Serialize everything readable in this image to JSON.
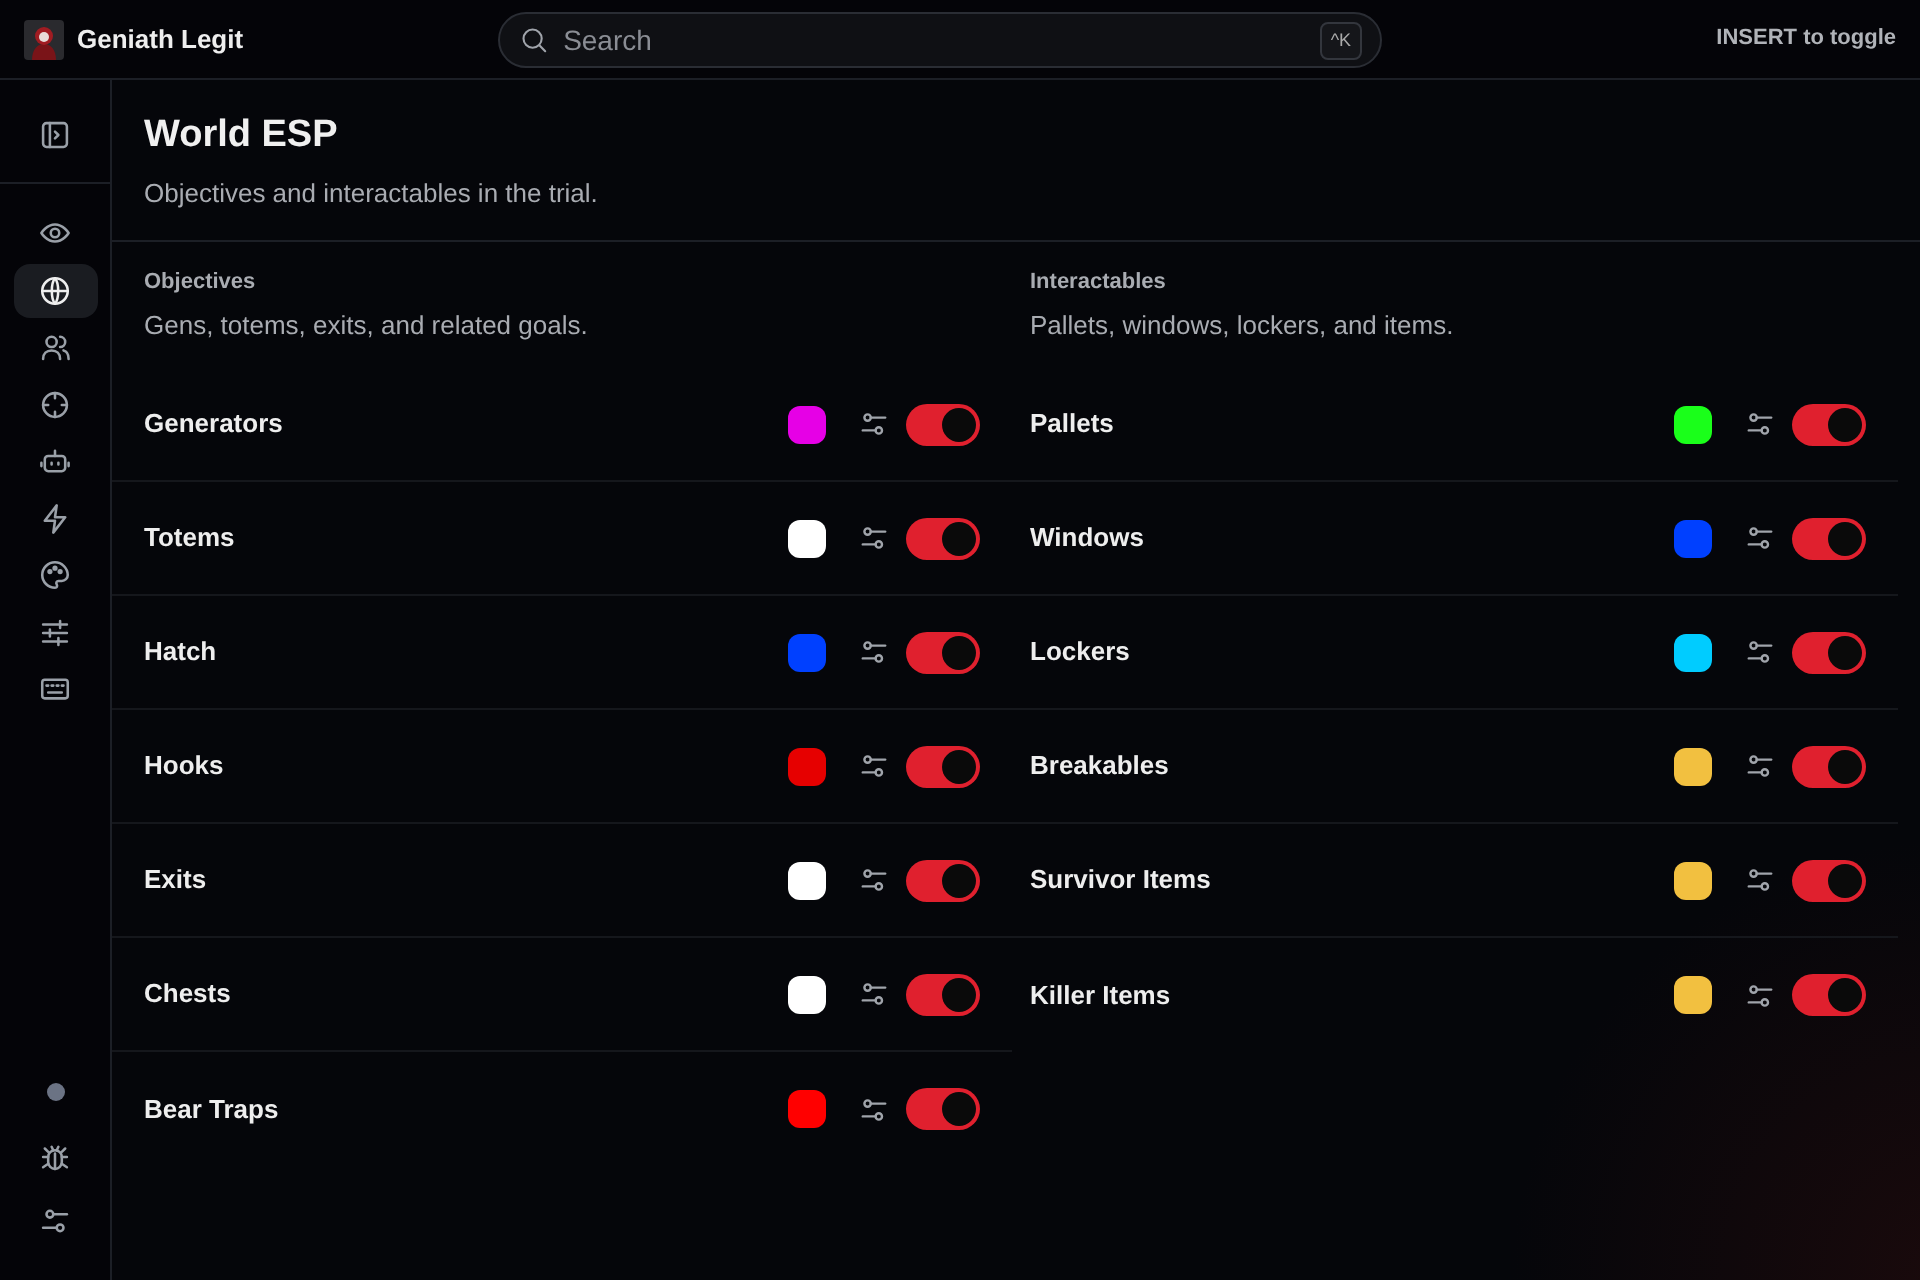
{
  "app": {
    "name": "Geniath Legit"
  },
  "search": {
    "placeholder": "Search",
    "shortcut": "^K"
  },
  "hint": "INSERT to toggle",
  "sidebar": {
    "top": [
      {
        "kind": "panel",
        "selected": false
      }
    ],
    "items": [
      {
        "kind": "eye",
        "selected": false
      },
      {
        "kind": "globe",
        "selected": true
      },
      {
        "kind": "users",
        "selected": false
      },
      {
        "kind": "crosshair",
        "selected": false
      },
      {
        "kind": "bot",
        "selected": false
      },
      {
        "kind": "bolt",
        "selected": false
      },
      {
        "kind": "palette",
        "selected": false
      },
      {
        "kind": "sliders",
        "selected": false
      },
      {
        "kind": "keyboard",
        "selected": false
      }
    ],
    "bottom": [
      {
        "kind": "dot",
        "selected": false
      },
      {
        "kind": "bug",
        "selected": false
      },
      {
        "kind": "settings",
        "selected": false
      }
    ]
  },
  "page": {
    "title": "World ESP",
    "subtitle": "Objectives and interactables in the trial."
  },
  "sections": [
    {
      "title": "Objectives",
      "description": "Gens, totems, exits, and related goals.",
      "items": [
        {
          "label": "Generators",
          "color": "#e600e6",
          "on": true
        },
        {
          "label": "Totems",
          "color": "#ffffff",
          "on": true
        },
        {
          "label": "Hatch",
          "color": "#0040ff",
          "on": true
        },
        {
          "label": "Hooks",
          "color": "#e60000",
          "on": true
        },
        {
          "label": "Exits",
          "color": "#ffffff",
          "on": true
        },
        {
          "label": "Chests",
          "color": "#ffffff",
          "on": true
        },
        {
          "label": "Bear Traps",
          "color": "#ff0000",
          "on": true
        }
      ]
    },
    {
      "title": "Interactables",
      "description": "Pallets, windows, lockers, and items.",
      "items": [
        {
          "label": "Pallets",
          "color": "#1aff1a",
          "on": true
        },
        {
          "label": "Windows",
          "color": "#0040ff",
          "on": true
        },
        {
          "label": "Lockers",
          "color": "#00ccff",
          "on": true
        },
        {
          "label": "Breakables",
          "color": "#f2c040",
          "on": true
        },
        {
          "label": "Survivor Items",
          "color": "#f2c040",
          "on": true
        },
        {
          "label": "Killer Items",
          "color": "#f2c040",
          "on": true
        }
      ]
    }
  ]
}
